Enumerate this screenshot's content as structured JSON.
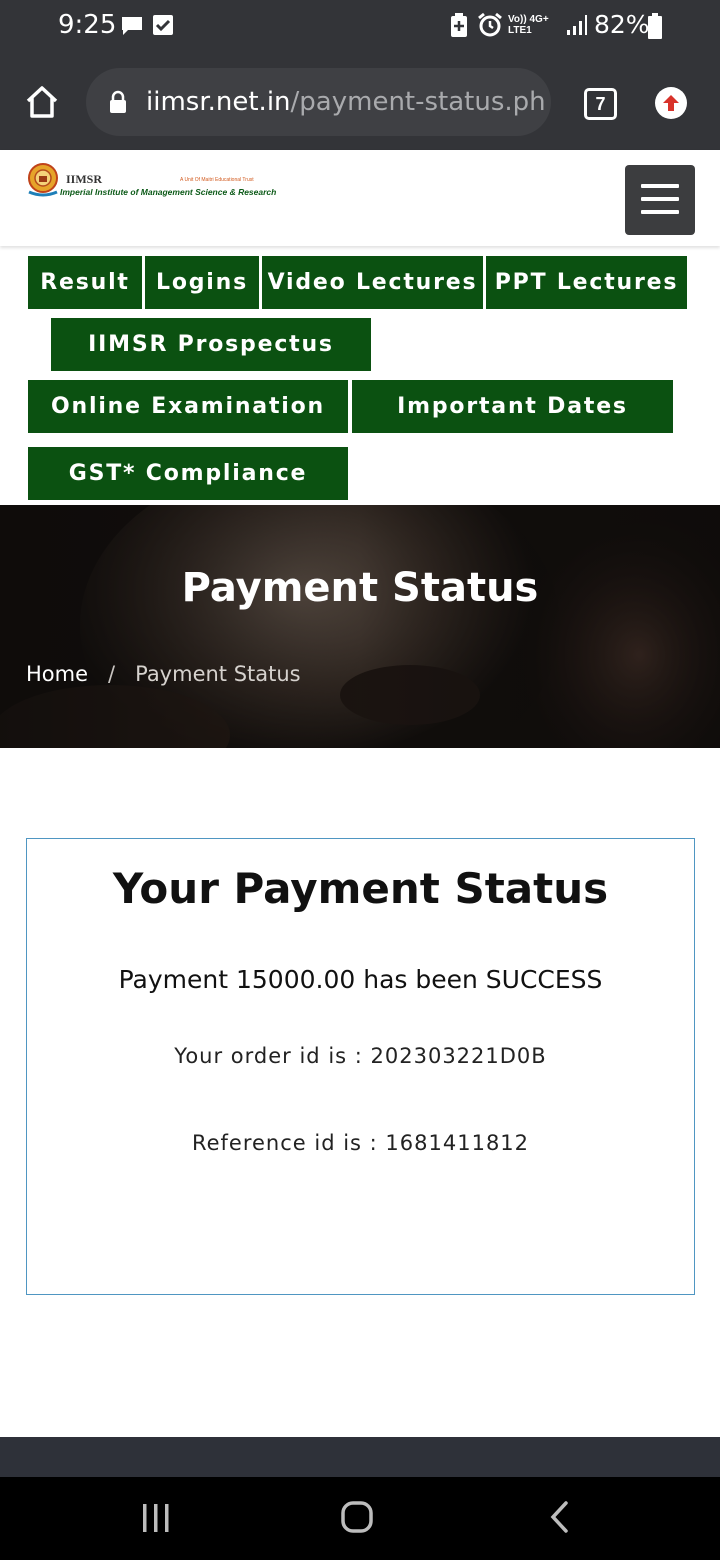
{
  "status_bar": {
    "time": "9:25",
    "battery": "82%",
    "network_top": "Vo)) 4G+",
    "network_bottom": "LTE1",
    "icons": [
      "chat-bubble-icon",
      "checkbox-icon",
      "battery-saver-icon",
      "alarm-icon",
      "signal-icon",
      "battery-icon"
    ]
  },
  "browser": {
    "url_domain": "iimsr.net.in",
    "url_path": "/payment-status.ph",
    "tab_count": "7",
    "icons": [
      "home-icon",
      "lock-icon",
      "update-arrow-icon"
    ]
  },
  "site": {
    "logo_abbr": "IIMSR",
    "logo_tagline": "A Unit Of Maitri Educational Trust",
    "logo_name": "Imperial Institute of Management Science & Research",
    "menu_icon": "hamburger-menu-icon"
  },
  "nav": {
    "result": "Result",
    "logins": "Logins",
    "video_lectures": "Video Lectures",
    "ppt_lectures": "PPT Lectures",
    "prospectus": "IIMSR Prospectus",
    "online_exam": "Online Examination",
    "important_dates": "Important Dates",
    "gst": "GST* Compliance"
  },
  "hero": {
    "title": "Payment Status",
    "breadcrumb_home": "Home",
    "breadcrumb_sep": "/",
    "breadcrumb_current": "Payment Status"
  },
  "card": {
    "title": "Your Payment Status",
    "message": "Payment 15000.00 has been SUCCESS",
    "order": "Your order id is : 202303221D0B",
    "reference": "Reference id is : 1681411812"
  },
  "colors": {
    "nav_green": "#0b5111",
    "browser_bar": "#333438",
    "card_border": "#4f96c2",
    "update_red": "#d8322a"
  }
}
